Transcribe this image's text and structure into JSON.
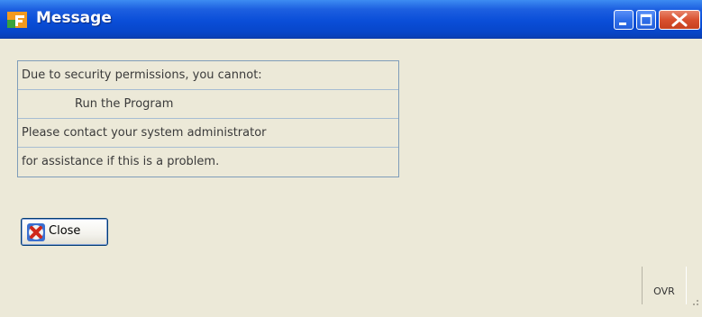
{
  "window": {
    "title": "Message",
    "app_icon": "app-logo-icon",
    "controls": {
      "minimize_icon": "minimize-icon",
      "maximize_icon": "maximize-icon",
      "close_icon": "close-icon"
    },
    "accent_color": "#0a4ed8"
  },
  "message": {
    "lines": [
      "Due to security permissions, you cannot:",
      "Run the Program",
      "Please contact your system administrator",
      "for assistance if this is a problem."
    ]
  },
  "actions": {
    "close_label": "Close",
    "close_icon": "red-x-icon"
  },
  "status_bar": {
    "mode": "OVR"
  }
}
